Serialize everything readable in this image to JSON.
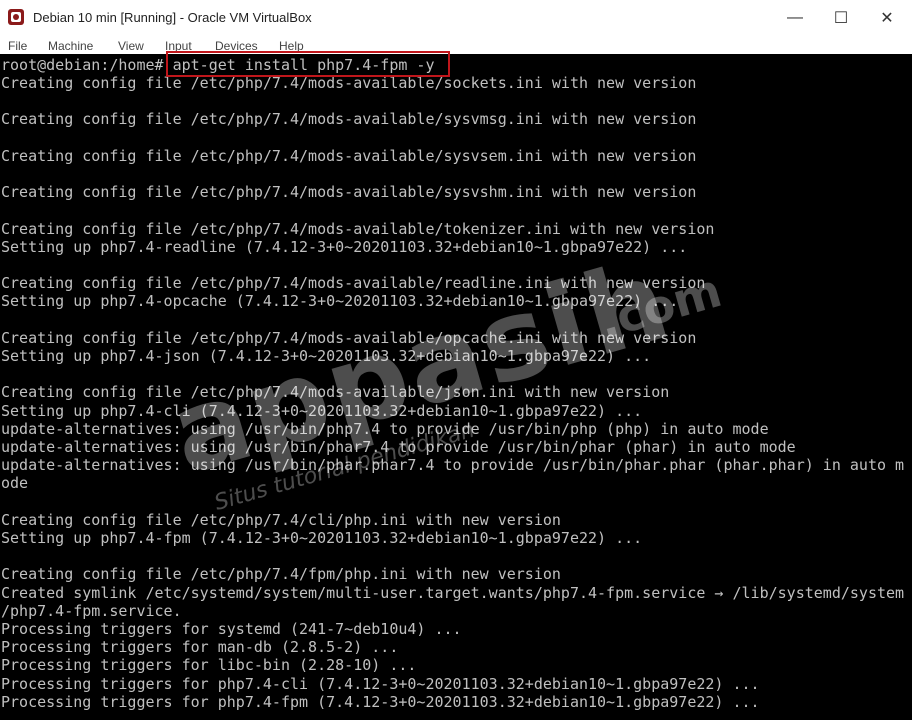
{
  "window": {
    "title": "Debian 10 min [Running] - Oracle VM VirtualBox",
    "app_icon": "virtualbox-icon",
    "controls": {
      "minimize": "—",
      "maximize": "☐",
      "close": "✕"
    }
  },
  "menu": {
    "items": [
      {
        "label": "File"
      },
      {
        "label": "Machine"
      },
      {
        "label": "View"
      },
      {
        "label": "Input"
      },
      {
        "label": "Devices"
      },
      {
        "label": "Help"
      }
    ]
  },
  "terminal": {
    "prompt": "root@debian:/home#",
    "command": "apt-get install php7.4-fpm -y",
    "lines": [
      "Creating config file /etc/php/7.4/mods-available/sockets.ini with new version",
      "",
      "Creating config file /etc/php/7.4/mods-available/sysvmsg.ini with new version",
      "",
      "Creating config file /etc/php/7.4/mods-available/sysvsem.ini with new version",
      "",
      "Creating config file /etc/php/7.4/mods-available/sysvshm.ini with new version",
      "",
      "Creating config file /etc/php/7.4/mods-available/tokenizer.ini with new version",
      "Setting up php7.4-readline (7.4.12-3+0~20201103.32+debian10~1.gbpa97e22) ...",
      "",
      "Creating config file /etc/php/7.4/mods-available/readline.ini with new version",
      "Setting up php7.4-opcache (7.4.12-3+0~20201103.32+debian10~1.gbpa97e22) ...",
      "",
      "Creating config file /etc/php/7.4/mods-available/opcache.ini with new version",
      "Setting up php7.4-json (7.4.12-3+0~20201103.32+debian10~1.gbpa97e22) ...",
      "",
      "Creating config file /etc/php/7.4/mods-available/json.ini with new version",
      "Setting up php7.4-cli (7.4.12-3+0~20201103.32+debian10~1.gbpa97e22) ...",
      "update-alternatives: using /usr/bin/php7.4 to provide /usr/bin/php (php) in auto mode",
      "update-alternatives: using /usr/bin/phar7.4 to provide /usr/bin/phar (phar) in auto mode",
      "update-alternatives: using /usr/bin/phar.phar7.4 to provide /usr/bin/phar.phar (phar.phar) in auto m",
      "ode",
      "",
      "Creating config file /etc/php/7.4/cli/php.ini with new version",
      "Setting up php7.4-fpm (7.4.12-3+0~20201103.32+debian10~1.gbpa97e22) ...",
      "",
      "Creating config file /etc/php/7.4/fpm/php.ini with new version",
      "Created symlink /etc/systemd/system/multi-user.target.wants/php7.4-fpm.service → /lib/systemd/system",
      "/php7.4-fpm.service.",
      "Processing triggers for systemd (241-7~deb10u4) ...",
      "Processing triggers for man-db (2.8.5-2) ...",
      "Processing triggers for libc-bin (2.28-10) ...",
      "Processing triggers for php7.4-cli (7.4.12-3+0~20201103.32+debian10~1.gbpa97e22) ...",
      "Processing triggers for php7.4-fpm (7.4.12-3+0~20201103.32+debian10~1.gbpa97e22) ..."
    ]
  },
  "watermark": {
    "logo": "appasih",
    "domain": ".com",
    "tagline": "Situs tutorial pendidikan"
  },
  "colors": {
    "terminal_bg": "#000000",
    "terminal_fg": "#c0c0c0",
    "highlight_border": "#c0161b"
  }
}
